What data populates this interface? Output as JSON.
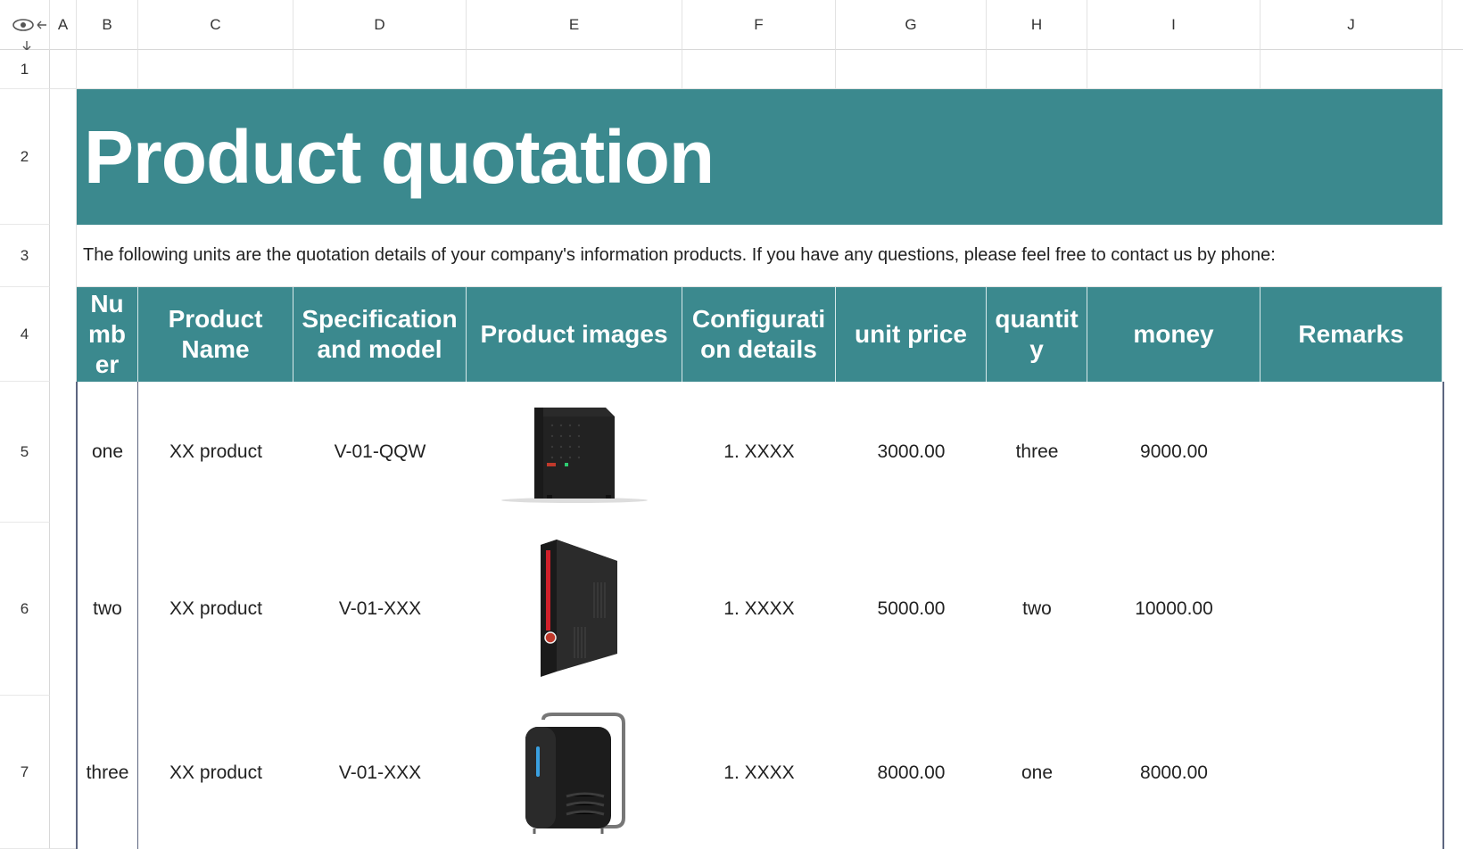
{
  "columns": [
    "A",
    "B",
    "C",
    "D",
    "E",
    "F",
    "G",
    "H",
    "I",
    "J"
  ],
  "rows": [
    "1",
    "2",
    "3",
    "4",
    "5",
    "6",
    "7"
  ],
  "title": "Product quotation",
  "subtitle": "The following units are the quotation details of your company's information products. If you have any questions, please feel free to contact us by phone:",
  "table": {
    "headers": [
      "Nu\nmb\ner",
      "Product\nName",
      "Specification\nand model",
      "Product images",
      "Configurati\non details",
      "unit price",
      "quantit\ny",
      "money",
      "Remarks"
    ],
    "rows": [
      {
        "number": "one",
        "name": "XX product",
        "model": "V-01-QQW",
        "image": "tower-pc-black",
        "config": "1. XXXX",
        "unit_price": "3000.00",
        "quantity": "three",
        "money": "9000.00",
        "remarks": ""
      },
      {
        "number": "two",
        "name": "XX product",
        "model": "V-01-XXX",
        "image": "tower-pc-red-stripe",
        "config": "1. XXXX",
        "unit_price": "5000.00",
        "quantity": "two",
        "money": "10000.00",
        "remarks": ""
      },
      {
        "number": "three",
        "name": "XX product",
        "model": "V-01-XXX",
        "image": "cube-pc-chrome",
        "config": "1. XXXX",
        "unit_price": "8000.00",
        "quantity": "one",
        "money": "8000.00",
        "remarks": ""
      }
    ]
  },
  "colors": {
    "accent": "#3b898e",
    "border": "#5d6680"
  }
}
